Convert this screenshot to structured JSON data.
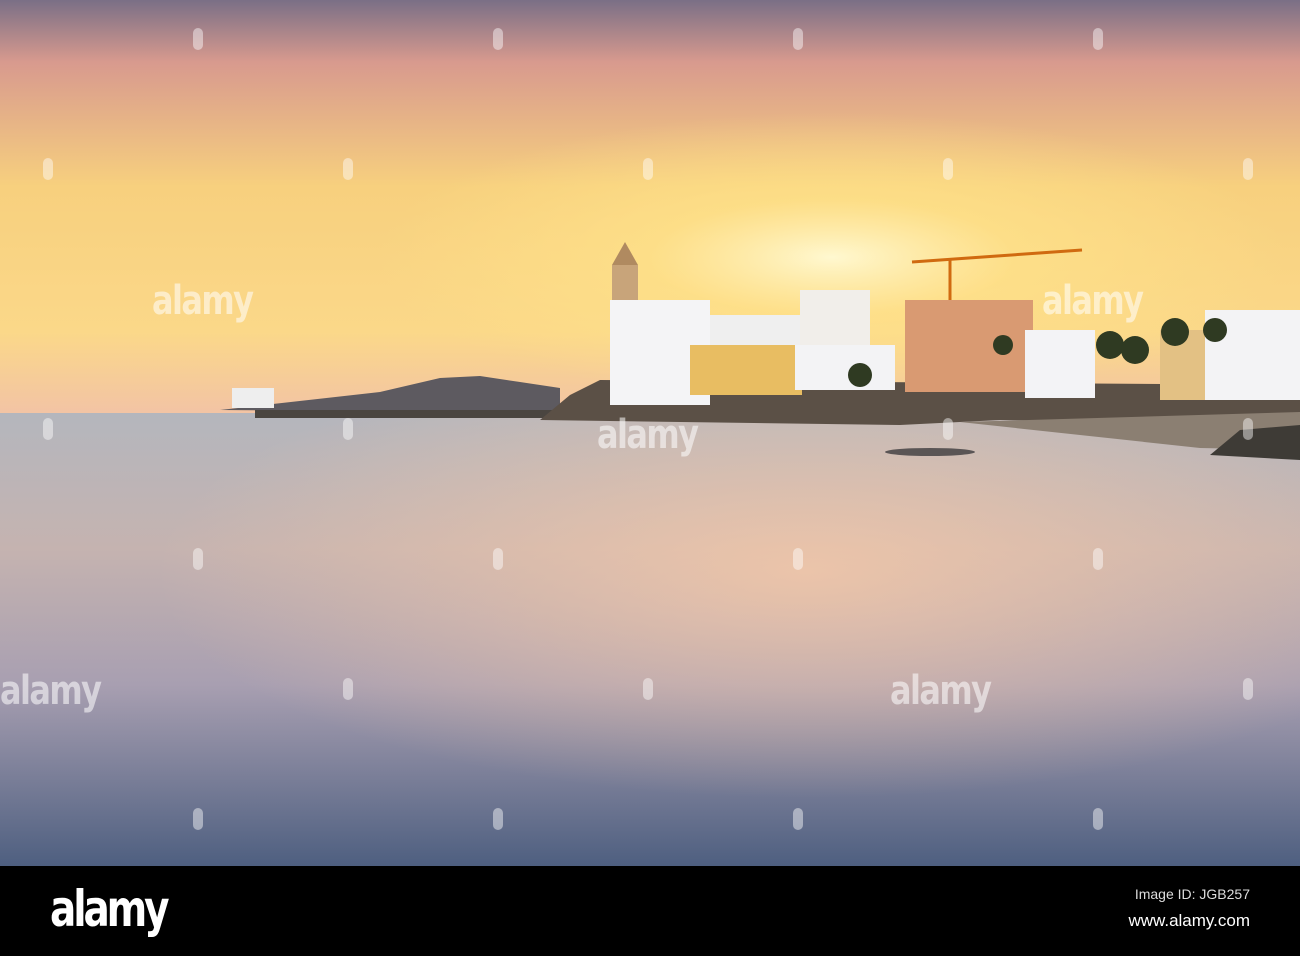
{
  "watermark": {
    "text": "alamy"
  },
  "footer": {
    "logo": "alamy",
    "image_id": "Image ID: JGB257",
    "url": "www.alamy.com"
  }
}
